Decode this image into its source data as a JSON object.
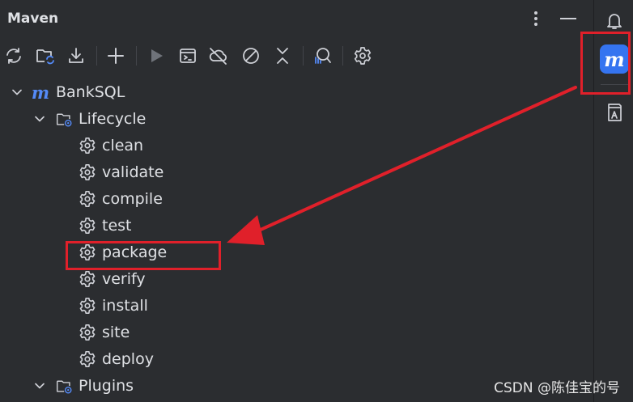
{
  "panel": {
    "title": "Maven",
    "header_buttons": [
      "more-options-icon",
      "minimize-icon"
    ]
  },
  "toolbar": {
    "buttons": [
      {
        "name": "reload-all-projects",
        "icon": "sync-icon"
      },
      {
        "name": "generate-sources",
        "icon": "folder-refresh-icon"
      },
      {
        "name": "download-sources",
        "icon": "download-icon"
      },
      {
        "name": "add-maven-project",
        "icon": "plus-icon"
      },
      {
        "name": "run-maven-build",
        "icon": "play-icon"
      },
      {
        "name": "execute-maven-goal",
        "icon": "terminal-icon"
      },
      {
        "name": "toggle-offline-mode",
        "icon": "cloud-off-icon"
      },
      {
        "name": "skip-tests",
        "icon": "no-entry-icon"
      },
      {
        "name": "collapse-all",
        "icon": "collapse-icon"
      },
      {
        "name": "analyze-dependencies",
        "icon": "search-dependencies-icon"
      },
      {
        "name": "maven-settings",
        "icon": "gear-icon"
      }
    ]
  },
  "tree": {
    "project": "BankSQL",
    "lifecycle_label": "Lifecycle",
    "goals": [
      "clean",
      "validate",
      "compile",
      "test",
      "package",
      "verify",
      "install",
      "site",
      "deploy"
    ],
    "plugins_label": "Plugins"
  },
  "rightbar": {
    "maven_letter": "m",
    "icons": [
      "notifications-icon",
      "maven-icon",
      "ai-assistant-icon"
    ]
  },
  "annotation": {
    "color": "#e0202a",
    "target_item": "package"
  },
  "watermark": "CSDN @陈佳宝的号",
  "colors": {
    "background": "#2b2d30",
    "text": "#dfe1e5",
    "icon": "#ced0d6",
    "accent": "#3574f0"
  }
}
